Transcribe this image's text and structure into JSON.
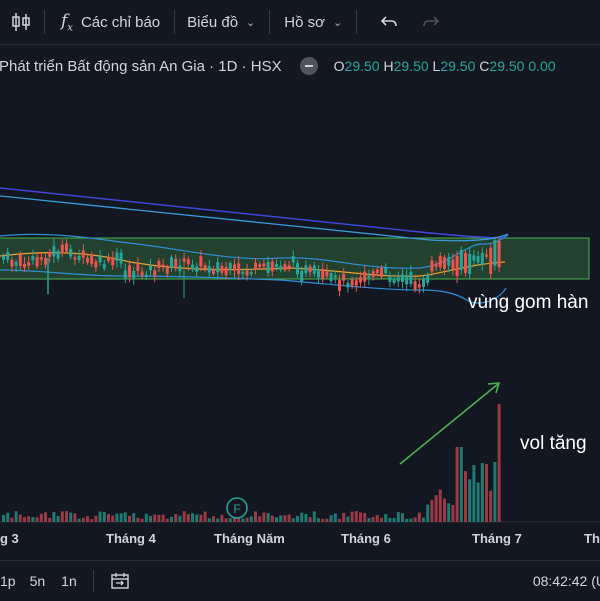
{
  "toolbar": {
    "indicators_label": "Các chỉ báo",
    "chart_menu_label": "Biểu đồ",
    "profile_menu_label": "Hồ sơ"
  },
  "legend": {
    "symbol_title": "Phát triển Bất động sản An Gia · 1D · HSX",
    "o_key": "O",
    "o_val": "29.50",
    "h_key": "H",
    "h_val": "29.50",
    "l_key": "L",
    "l_val": "29.50",
    "c_key": "C",
    "c_val": "29.50",
    "extra": "0.00"
  },
  "annotations": {
    "accumulation_zone": "vùng gom hàn",
    "volume_rising": "vol tăng"
  },
  "time_axis": {
    "labels": [
      "g 3",
      "Tháng 4",
      "Tháng Năm",
      "Tháng 6",
      "Tháng 7",
      "Th"
    ]
  },
  "event_marker": "F",
  "bottom": {
    "ranges": [
      "1p",
      "5n",
      "1n"
    ],
    "clock": "08:42:42 (U"
  },
  "colors": {
    "background": "#131722",
    "up": "#26a69a",
    "down": "#ef5350",
    "zone_fill": "#4caf50",
    "annotation_arrow": "#4caf50"
  }
}
